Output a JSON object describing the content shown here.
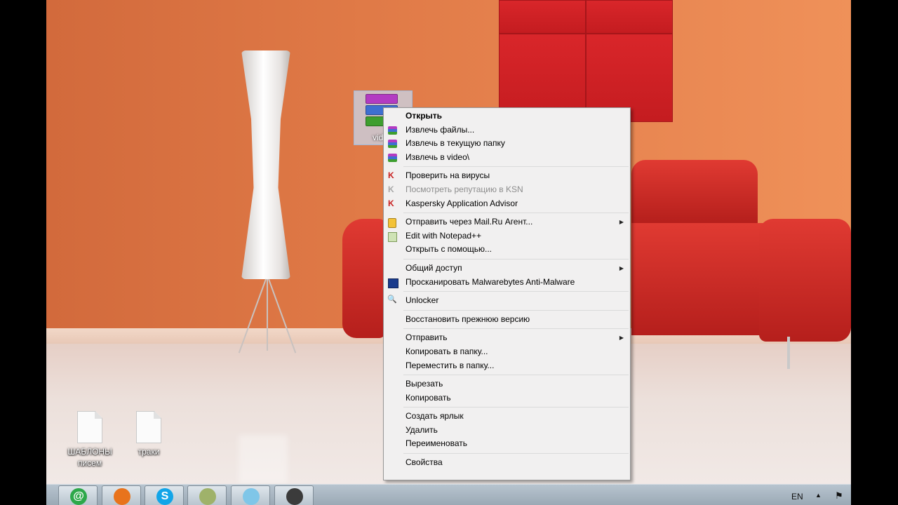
{
  "desktop": {
    "selected_file": {
      "name": "vid",
      "icon": "winrar-archive-icon"
    },
    "icons": [
      {
        "label": "ШАБЛОНЫ\nписем",
        "icon": "document-icon"
      },
      {
        "label": "траки",
        "icon": "document-icon"
      }
    ]
  },
  "context_menu": {
    "groups": [
      [
        {
          "label": "Открыть",
          "bold": true
        },
        {
          "label": "Извлечь файлы...",
          "icon": "winrar-icon"
        },
        {
          "label": "Извлечь в текущую папку",
          "icon": "winrar-icon"
        },
        {
          "label": "Извлечь в video\\",
          "icon": "winrar-icon"
        }
      ],
      [
        {
          "label": "Проверить на вирусы",
          "icon": "kaspersky-icon"
        },
        {
          "label": "Посмотреть репутацию в KSN",
          "icon": "kaspersky-icon",
          "disabled": true
        },
        {
          "label": "Kaspersky Application Advisor",
          "icon": "kaspersky-icon"
        }
      ],
      [
        {
          "label": "Отправить через Mail.Ru Агент...",
          "icon": "mailru-agent-icon",
          "submenu": true
        },
        {
          "label": "Edit with Notepad++",
          "icon": "notepadpp-icon"
        },
        {
          "label": "Открыть с помощью..."
        }
      ],
      [
        {
          "label": "Общий доступ",
          "submenu": true
        },
        {
          "label": "Просканировать Malwarebytes Anti-Malware",
          "icon": "malwarebytes-icon"
        }
      ],
      [
        {
          "label": "Unlocker",
          "icon": "unlocker-icon"
        }
      ],
      [
        {
          "label": "Восстановить прежнюю версию"
        }
      ],
      [
        {
          "label": "Отправить",
          "submenu": true
        },
        {
          "label": "Копировать в папку..."
        },
        {
          "label": "Переместить в папку..."
        }
      ],
      [
        {
          "label": "Вырезать"
        },
        {
          "label": "Копировать"
        }
      ],
      [
        {
          "label": "Создать ярлык"
        },
        {
          "label": "Удалить"
        },
        {
          "label": "Переименовать"
        }
      ],
      [
        {
          "label": "Свойства"
        }
      ]
    ]
  },
  "taskbar": {
    "apps": [
      {
        "name": "mailru-agent-icon",
        "glyph": "@",
        "color": "#2ea84a"
      },
      {
        "name": "firefox-icon",
        "glyph": "",
        "color": "#e8731c"
      },
      {
        "name": "skype-icon",
        "glyph": "S",
        "color": "#12a5e8"
      },
      {
        "name": "winamp-icon",
        "glyph": "",
        "color": "#9fb26a"
      },
      {
        "name": "notepad-icon",
        "glyph": "",
        "color": "#7fc6e8"
      },
      {
        "name": "camera-app-icon",
        "glyph": "",
        "color": "#3b3b3b"
      }
    ],
    "tray": {
      "language": "EN",
      "show_hidden_arrow": "▲",
      "flag": "⚑"
    }
  }
}
